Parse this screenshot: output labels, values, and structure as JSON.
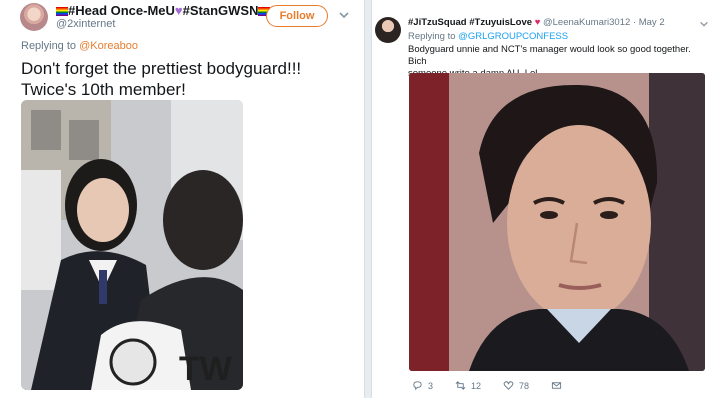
{
  "left_tweet": {
    "display_name_parts": {
      "part1": "#Head Once-MeU",
      "part2": "#StanGWSN"
    },
    "handle": "@2xinternet",
    "follow_label": "Follow",
    "replying_to_prefix": "Replying to ",
    "replying_to_handle": "@Koreaboo",
    "text_line1": "Don't forget the prettiest bodyguard!!!",
    "text_line2": "Twice's 10th member!"
  },
  "right_tweet": {
    "display_name": "#JiTzuSquad #TzuyuisLove",
    "handle": "@LeenaKumari3012",
    "separator": " · ",
    "date": "May 2",
    "replying_to_prefix": "Replying to ",
    "replying_to_handle": "@GRLGROUPCONFESS",
    "text_line1": "Bodyguard unnie and NCT's manager would look so good together. Bich",
    "text_line2": "someone write a damn AU. Lol.",
    "actions": {
      "reply_count": "3",
      "retweet_count": "12",
      "like_count": "78"
    }
  },
  "colors": {
    "follow_accent": "#e87d2f",
    "link_blue": "#1da1f2",
    "heart_red": "#e0245e",
    "heart_purple": "#a56bd6"
  },
  "icons": {
    "chevron": "chevron-down-icon",
    "reply": "reply-icon",
    "retweet": "retweet-icon",
    "like": "heart-icon",
    "dm": "envelope-icon"
  }
}
